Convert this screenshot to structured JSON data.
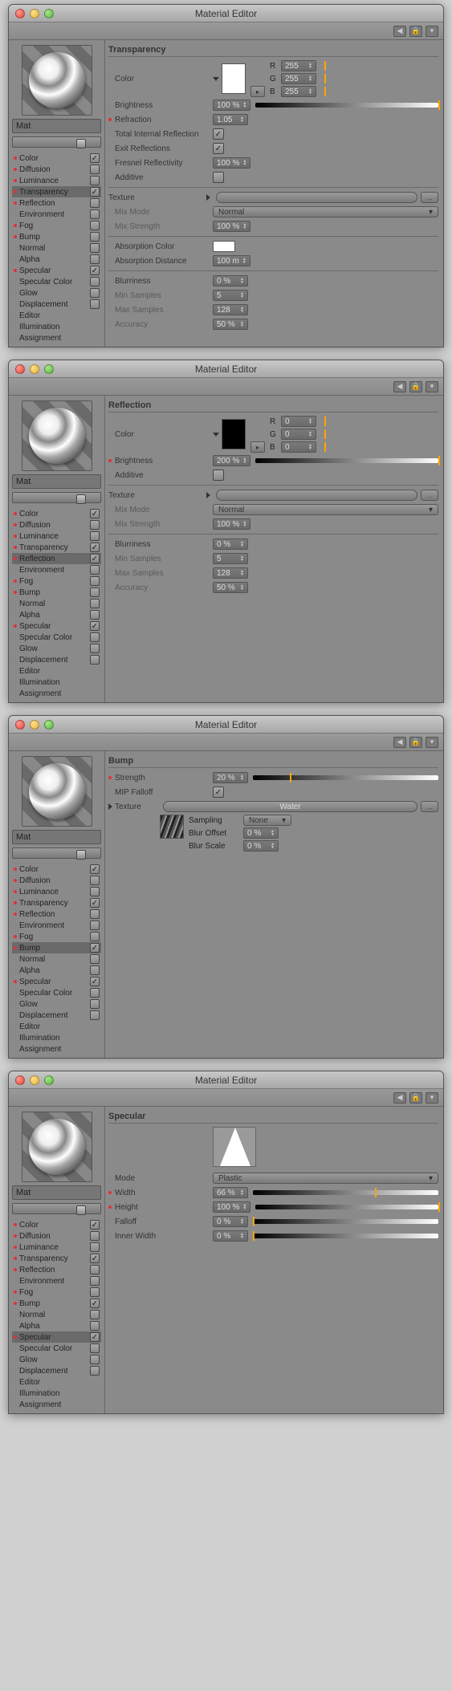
{
  "app_title": "Material Editor",
  "mat_label": "Mat",
  "channels": [
    {
      "name": "Color",
      "dot": "red",
      "cb": true
    },
    {
      "name": "Diffusion",
      "dot": "red",
      "cb": false
    },
    {
      "name": "Luminance",
      "dot": "red",
      "cb": false
    },
    {
      "name": "Transparency",
      "dot": "red",
      "cb": true
    },
    {
      "name": "Reflection",
      "dot": "red",
      "cb": false
    },
    {
      "name": "Environment",
      "dot": "none",
      "cb": false
    },
    {
      "name": "Fog",
      "dot": "red",
      "cb": false
    },
    {
      "name": "Bump",
      "dot": "red",
      "cb": false
    },
    {
      "name": "Normal",
      "dot": "none",
      "cb": false
    },
    {
      "name": "Alpha",
      "dot": "none",
      "cb": false
    },
    {
      "name": "Specular",
      "dot": "red",
      "cb": true
    },
    {
      "name": "Specular Color",
      "dot": "none",
      "cb": false
    },
    {
      "name": "Glow",
      "dot": "none",
      "cb": false
    },
    {
      "name": "Displacement",
      "dot": "none",
      "cb": false
    },
    {
      "name": "Editor",
      "noCb": true
    },
    {
      "name": "Illumination",
      "noCb": true
    },
    {
      "name": "Assignment",
      "noCb": true
    }
  ],
  "panels": [
    {
      "id": "transparency",
      "title": "Transparency",
      "selected": "Transparency",
      "channel_overrides": {},
      "color_block": {
        "swatch": "white",
        "r": "255",
        "g": "255",
        "b": "255",
        "mark": 100
      },
      "rows": [
        {
          "lbl": "Brightness",
          "dot": "none",
          "val": "100 %",
          "bar": "grad-bw",
          "mark": 100
        },
        {
          "lbl": "Refraction",
          "dot": "red",
          "val": "1.05"
        },
        {
          "lbl": "Total Internal Reflection",
          "dot": "none",
          "cb": true
        },
        {
          "lbl": "Exit Reflections",
          "dot": "none",
          "cb": true
        },
        {
          "lbl": "Fresnel Reflectivity",
          "dot": "none",
          "val": "100 %"
        },
        {
          "lbl": "Additive",
          "dot": "none",
          "cb": false
        }
      ],
      "texture": {
        "mix_mode": "Normal",
        "mix_strength": "100 %"
      },
      "extra": [
        {
          "lbl": "Absorption Color",
          "dot": "none",
          "swatch": "white"
        },
        {
          "lbl": "Absorption Distance",
          "dot": "none",
          "val": "100 m"
        }
      ],
      "blur": {
        "val": "0 %",
        "min": "5",
        "max": "128",
        "acc": "50 %"
      }
    },
    {
      "id": "reflection",
      "title": "Reflection",
      "selected": "Reflection",
      "channel_overrides": {
        "Reflection": true,
        "Transparency": true
      },
      "color_block": {
        "swatch": "black",
        "r": "0",
        "g": "0",
        "b": "0",
        "mark": 0
      },
      "rows": [
        {
          "lbl": "Brightness",
          "dot": "red",
          "val": "200 %",
          "bar": "grad-bw",
          "mark": 100
        },
        {
          "lbl": "Additive",
          "dot": "none",
          "cb": false
        }
      ],
      "texture": {
        "mix_mode": "Normal",
        "mix_strength": "100 %"
      },
      "blur": {
        "val": "0 %",
        "min": "5",
        "max": "128",
        "acc": "50 %"
      }
    },
    {
      "id": "bump",
      "title": "Bump",
      "selected": "Bump",
      "channel_overrides": {
        "Bump": true,
        "Reflection": false,
        "Transparency": true
      },
      "rows": [
        {
          "lbl": "Strength",
          "dot": "red",
          "val": "20 %",
          "bar": "grad-bw",
          "mark": 20
        },
        {
          "lbl": "MIP Falloff",
          "dot": "none",
          "cb": true
        }
      ],
      "bump_tex": {
        "name": "Water",
        "sampling": "None",
        "blur_offset": "0 %",
        "blur_scale": "0 %"
      }
    },
    {
      "id": "specular",
      "title": "Specular",
      "selected": "Specular",
      "channel_overrides": {
        "Bump": true,
        "Reflection": false,
        "Transparency": true
      },
      "spec_preview": true,
      "rows": [
        {
          "lbl": "Mode",
          "dot": "none",
          "dropdown": "Plastic"
        },
        {
          "lbl": "Width",
          "dot": "red",
          "val": "66 %",
          "bar": "grad-bw",
          "mark": 66
        },
        {
          "lbl": "Height",
          "dot": "red",
          "val": "100 %",
          "bar": "grad-bw",
          "mark": 100
        },
        {
          "lbl": "Falloff",
          "dot": "none",
          "val": "0 %",
          "bar": "grad-bw",
          "mark": 0
        },
        {
          "lbl": "Inner Width",
          "dot": "none",
          "val": "0 %",
          "bar": "grad-bw",
          "mark": 0
        }
      ]
    }
  ],
  "labels": {
    "texture": "Texture",
    "mix_mode": "Mix Mode",
    "mix_strength": "Mix Strength",
    "blurriness": "Blurriness",
    "min_samples": "Min Samples",
    "max_samples": "Max Samples",
    "accuracy": "Accuracy",
    "sampling": "Sampling",
    "blur_offset": "Blur Offset",
    "blur_scale": "Blur Scale",
    "color": "Color"
  }
}
